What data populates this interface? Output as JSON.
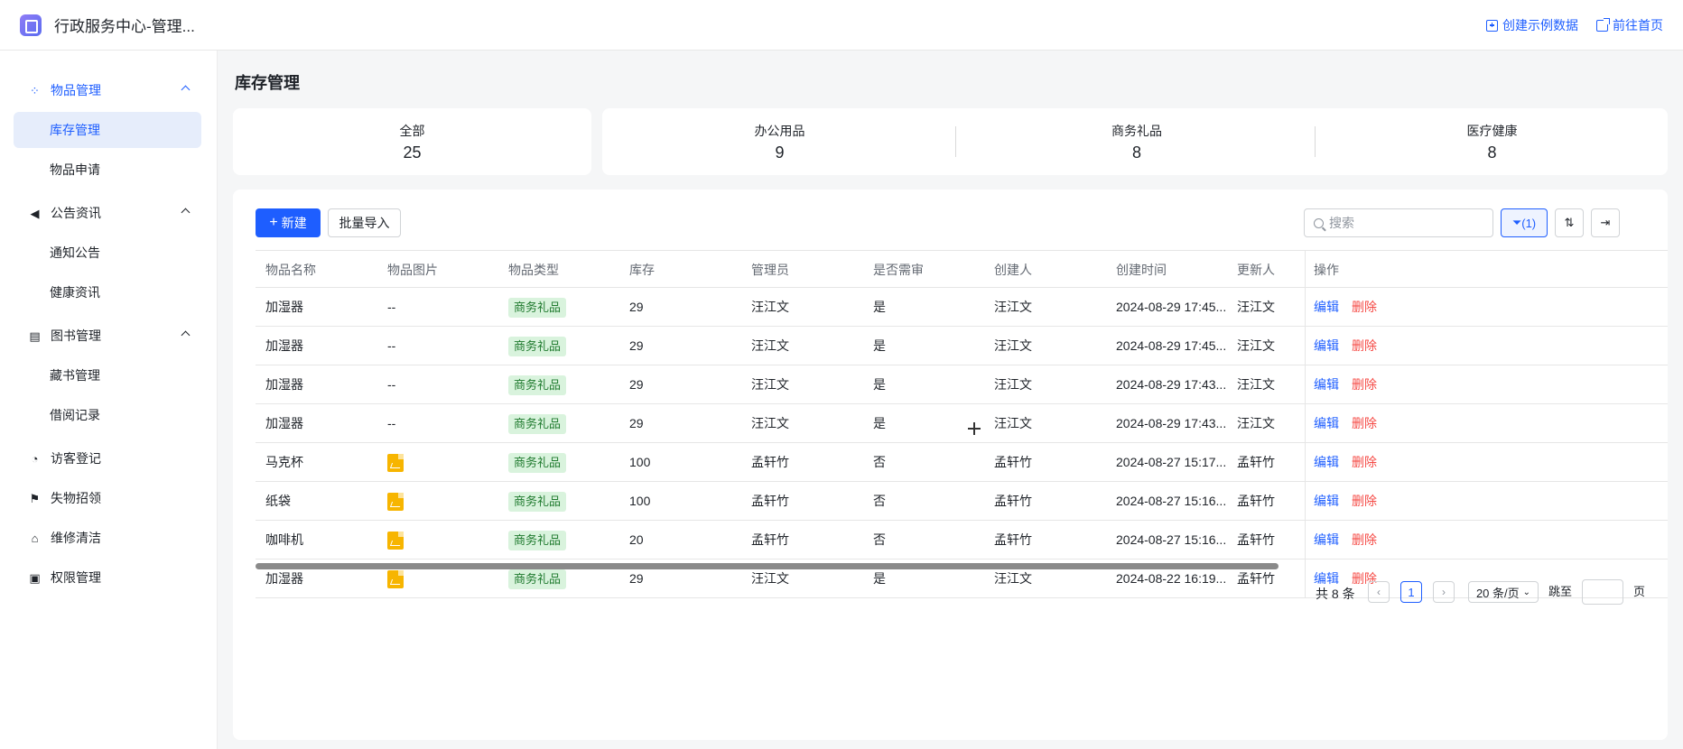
{
  "header": {
    "app_title": "行政服务中心-管理...",
    "create_sample_data": "创建示例数据",
    "go_home": "前往首页"
  },
  "sidebar": {
    "groups": [
      {
        "label": "物品管理",
        "icon": "apps-icon"
      },
      {
        "label": "公告资讯",
        "icon": "megaphone-icon"
      },
      {
        "label": "图书管理",
        "icon": "clipboard-icon"
      }
    ],
    "items": {
      "inventory": "库存管理",
      "item_request": "物品申请",
      "notice": "通知公告",
      "health_news": "健康资讯",
      "book_collection": "藏书管理",
      "borrow_records": "借阅记录",
      "visitor": "访客登记",
      "lost_found": "失物招领",
      "maintenance": "维修清洁",
      "permissions": "权限管理"
    }
  },
  "page": {
    "title": "库存管理"
  },
  "stats": {
    "all": {
      "label": "全部",
      "value": "25"
    },
    "office": {
      "label": "办公用品",
      "value": "9"
    },
    "gift": {
      "label": "商务礼品",
      "value": "8"
    },
    "health": {
      "label": "医疗健康",
      "value": "8"
    }
  },
  "toolbar": {
    "new_label": "新建",
    "import_label": "批量导入",
    "search_placeholder": "搜索",
    "filter_label": "(1)"
  },
  "table": {
    "columns": [
      "物品名称",
      "物品图片",
      "物品类型",
      "库存",
      "管理员",
      "是否需审",
      "创建人",
      "创建时间",
      "更新人",
      "操作"
    ],
    "rows": [
      {
        "name": "加湿器",
        "image": "--",
        "type": "商务礼品",
        "stock": "29",
        "admin": "汪江文",
        "review": "是",
        "creator": "汪江文",
        "created": "2024-08-29 17:45...",
        "updater": "汪江文"
      },
      {
        "name": "加湿器",
        "image": "--",
        "type": "商务礼品",
        "stock": "29",
        "admin": "汪江文",
        "review": "是",
        "creator": "汪江文",
        "created": "2024-08-29 17:45...",
        "updater": "汪江文"
      },
      {
        "name": "加湿器",
        "image": "--",
        "type": "商务礼品",
        "stock": "29",
        "admin": "汪江文",
        "review": "是",
        "creator": "汪江文",
        "created": "2024-08-29 17:43...",
        "updater": "汪江文"
      },
      {
        "name": "加湿器",
        "image": "--",
        "type": "商务礼品",
        "stock": "29",
        "admin": "汪江文",
        "review": "是",
        "creator": "汪江文",
        "created": "2024-08-29 17:43...",
        "updater": "汪江文"
      },
      {
        "name": "马克杯",
        "image": "",
        "type": "商务礼品",
        "stock": "100",
        "admin": "孟轩竹",
        "review": "否",
        "creator": "孟轩竹",
        "created": "2024-08-27 15:17...",
        "updater": "孟轩竹"
      },
      {
        "name": "纸袋",
        "image": "",
        "type": "商务礼品",
        "stock": "100",
        "admin": "孟轩竹",
        "review": "否",
        "creator": "孟轩竹",
        "created": "2024-08-27 15:16...",
        "updater": "孟轩竹"
      },
      {
        "name": "咖啡机",
        "image": "",
        "type": "商务礼品",
        "stock": "20",
        "admin": "孟轩竹",
        "review": "否",
        "creator": "孟轩竹",
        "created": "2024-08-27 15:16...",
        "updater": "孟轩竹"
      },
      {
        "name": "加湿器",
        "image": "",
        "type": "商务礼品",
        "stock": "29",
        "admin": "汪江文",
        "review": "是",
        "creator": "汪江文",
        "created": "2024-08-22 16:19...",
        "updater": "孟轩竹"
      }
    ],
    "edit_label": "编辑",
    "delete_label": "删除"
  },
  "pagination": {
    "total": "共 8 条",
    "current_page": "1",
    "page_size": "20 条/页",
    "jump_label": "跳至",
    "page_label": "页"
  },
  "colors": {
    "accent": "#1e5eff",
    "danger": "#f54a45",
    "tag_bg": "#d9f3dd",
    "tag_text": "#1f7a2e"
  }
}
